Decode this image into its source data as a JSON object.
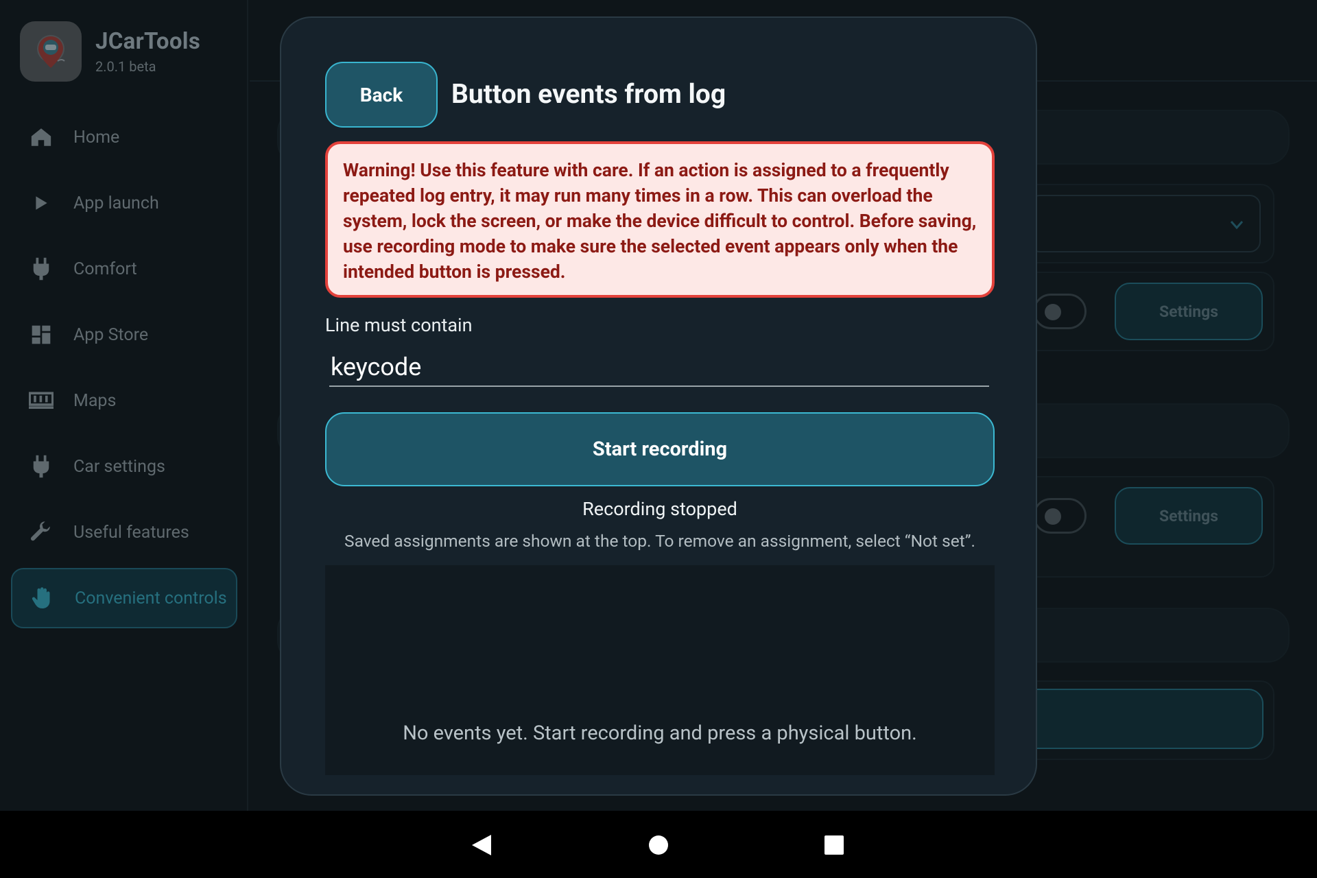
{
  "app": {
    "title": "JCarTools",
    "version": "2.0.1 beta"
  },
  "sidebar": {
    "items": [
      {
        "label": "Home",
        "icon": "home-icon",
        "active": false
      },
      {
        "label": "App launch",
        "icon": "play-icon",
        "active": false
      },
      {
        "label": "Comfort",
        "icon": "plug-icon",
        "active": false
      },
      {
        "label": "App Store",
        "icon": "dashboard-icon",
        "active": false
      },
      {
        "label": "Maps",
        "icon": "map-icon",
        "active": false
      },
      {
        "label": "Car settings",
        "icon": "plug-icon",
        "active": false
      },
      {
        "label": "Useful features",
        "icon": "wrench-icon",
        "active": false
      },
      {
        "label": "Convenient controls",
        "icon": "hand-icon",
        "active": true
      }
    ]
  },
  "background": {
    "settings_label": "Settings"
  },
  "modal": {
    "back_label": "Back",
    "title": "Button events from log",
    "warning": "Warning! Use this feature with care. If an action is assigned to a frequently repeated log entry, it may run many times in a row. This can overload the system, lock the screen, or make the device difficult to control. Before saving, use recording mode to make sure the selected event appears only when the intended button is pressed.",
    "field_label": "Line must contain",
    "field_value": "keycode",
    "record_button": "Start recording",
    "status": "Recording stopped",
    "hint": "Saved assignments are shown at the top. To remove an assignment, select “Not set”.",
    "empty_events": "No events yet. Start recording and press a physical button."
  },
  "colors": {
    "accent": "#39b5cf",
    "warning_border": "#e3413b",
    "warning_bg": "#fde8e6",
    "warning_text": "#8c1a14",
    "modal_bg": "#16222b"
  },
  "system_nav": {
    "back_icon": "triangle-back-icon",
    "home_icon": "circle-home-icon",
    "recents_icon": "square-recents-icon"
  }
}
